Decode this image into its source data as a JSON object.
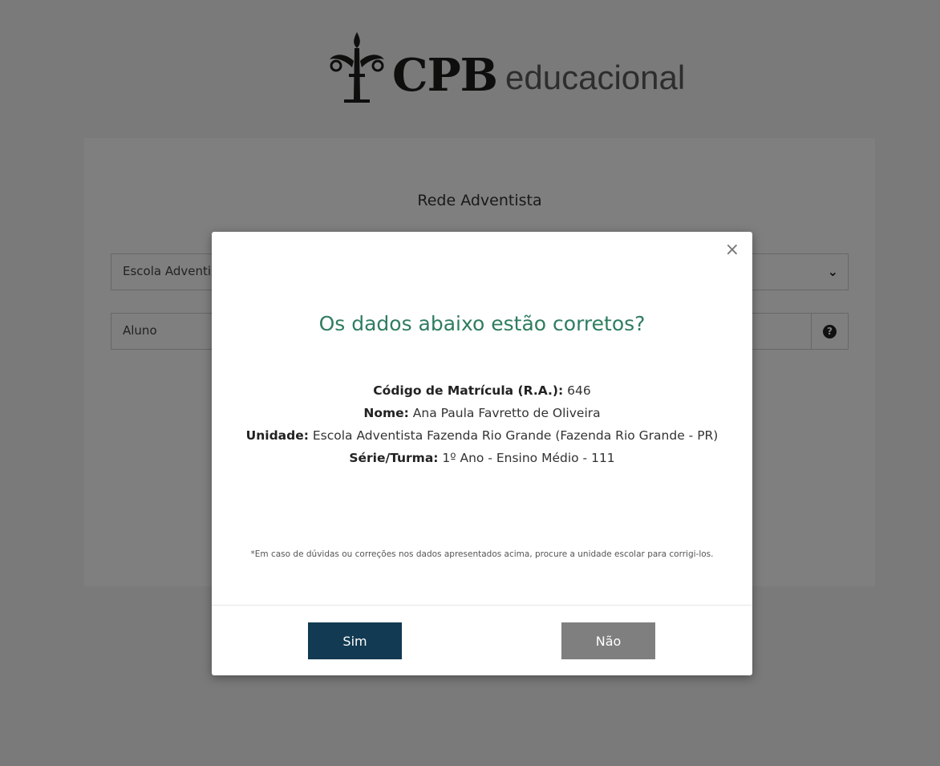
{
  "logo": {
    "brand": "CPB",
    "sub": "educacional"
  },
  "card": {
    "title": "Rede Adventista",
    "school_field_value": "Escola Adventista Fazenda Rio Grande",
    "role_field_value": "Aluno",
    "school_field_icon": "chevron-down-icon",
    "role_field_icon": "help-icon"
  },
  "modal": {
    "close_label": "×",
    "heading": "Os dados abaixo estão corretos?",
    "fields": {
      "ra_label": "Código de Matrícula (R.A.):",
      "ra_value": " 646",
      "name_label": "Nome:",
      "name_value": " Ana Paula Favretto de Oliveira",
      "unit_label": "Unidade:",
      "unit_value": " Escola Adventista Fazenda Rio Grande (Fazenda Rio Grande - PR)",
      "class_label": "Série/Turma:",
      "class_value": " 1º Ano - Ensino Médio - 111"
    },
    "note": "*Em caso de dúvidas ou correções nos dados apresentados acima, procure a unidade escolar para corrigi-los.",
    "yes_label": "Sim",
    "no_label": "Não"
  },
  "colors": {
    "heading_green": "#2f7d5f",
    "yes_button": "#123a52",
    "no_button": "#7f7f7f"
  }
}
